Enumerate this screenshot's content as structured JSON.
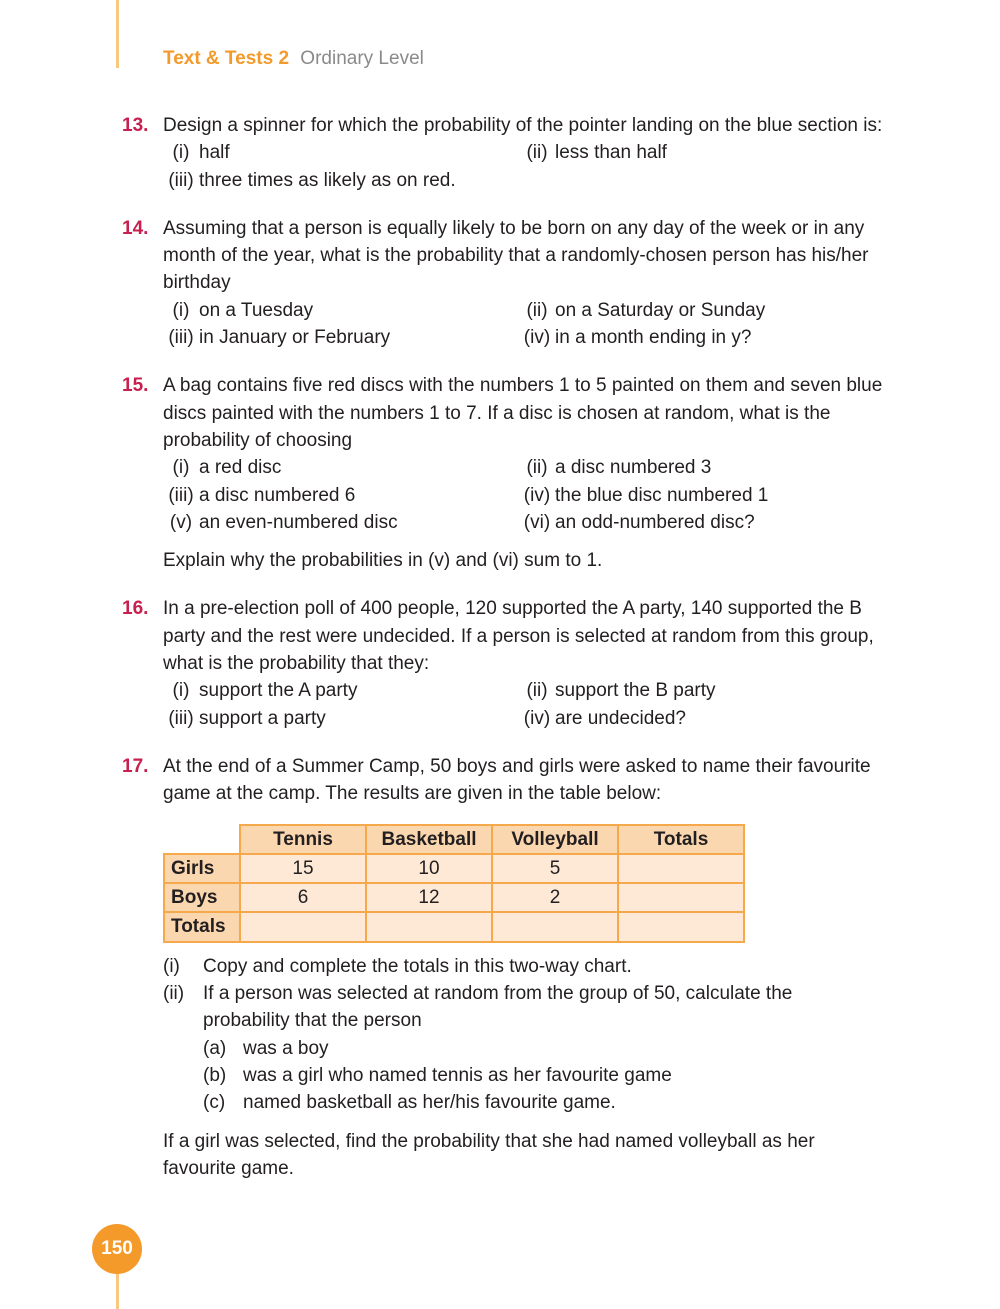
{
  "header": {
    "brand": "Text & Tests 2",
    "level": "Ordinary Level"
  },
  "page_number": "150",
  "questions": [
    {
      "number": "13.",
      "text": "Design a spinner for which the probability of the pointer landing on the blue section is:",
      "parts": [
        {
          "label": "(i)",
          "text": "half"
        },
        {
          "label": "(ii)",
          "text": "less than half"
        },
        {
          "label": "(iii)",
          "text": "three times as likely as on red."
        }
      ]
    },
    {
      "number": "14.",
      "text": "Assuming that a person is equally likely to be born on any day of the week or in any month of the year, what is the probability that a randomly-chosen person has his/her birthday",
      "parts": [
        {
          "label": "(i)",
          "text": "on a Tuesday"
        },
        {
          "label": "(ii)",
          "text": "on a Saturday or Sunday"
        },
        {
          "label": "(iii)",
          "text": "in January or February"
        },
        {
          "label": "(iv)",
          "text": "in a month ending in y?"
        }
      ]
    },
    {
      "number": "15.",
      "text": "A bag contains five red discs with the numbers 1 to 5 painted on them and seven blue discs painted with the numbers 1 to 7. If a disc is chosen at random, what is the probability of choosing",
      "parts": [
        {
          "label": "(i)",
          "text": "a red disc"
        },
        {
          "label": "(ii)",
          "text": "a disc numbered 3"
        },
        {
          "label": "(iii)",
          "text": "a disc numbered 6"
        },
        {
          "label": "(iv)",
          "text": "the blue disc numbered 1"
        },
        {
          "label": "(v)",
          "text": "an even-numbered disc"
        },
        {
          "label": "(vi)",
          "text": "an odd-numbered disc?"
        }
      ],
      "note": "Explain why the probabilities in (v) and (vi) sum to 1."
    },
    {
      "number": "16.",
      "text": "In a pre-election poll of 400 people, 120 supported the A party, 140 supported the B party and the rest were undecided. If a person is selected at random from this group, what is the probability that they:",
      "parts": [
        {
          "label": "(i)",
          "text": "support the A party"
        },
        {
          "label": "(ii)",
          "text": "support the B party"
        },
        {
          "label": "(iii)",
          "text": "support a party"
        },
        {
          "label": "(iv)",
          "text": "are undecided?"
        }
      ]
    },
    {
      "number": "17.",
      "text": "At the end of a Summer Camp, 50 boys and girls were asked to name their favourite game at the camp. The results are given in the table below:",
      "table": {
        "headers": [
          "Tennis",
          "Basketball",
          "Volleyball",
          "Totals"
        ],
        "rows": [
          {
            "label": "Girls",
            "cells": [
              "15",
              "10",
              "5",
              ""
            ]
          },
          {
            "label": "Boys",
            "cells": [
              "6",
              "12",
              "2",
              ""
            ]
          },
          {
            "label": "Totals",
            "cells": [
              "",
              "",
              "",
              ""
            ]
          }
        ]
      },
      "parts": [
        {
          "label": "(i)",
          "text": "Copy and complete the totals in this two-way chart."
        },
        {
          "label": "(ii)",
          "text": "If a person was selected at random from the group of 50, calculate the probability that the person"
        }
      ],
      "subparts": [
        {
          "label": "(a)",
          "text": "was a boy"
        },
        {
          "label": "(b)",
          "text": "was a girl who named tennis as her favourite game"
        },
        {
          "label": "(c)",
          "text": "named basketball as her/his favourite game."
        }
      ],
      "note": "If a girl was selected, find the probability that she had named volleyball as her favourite game."
    }
  ]
}
